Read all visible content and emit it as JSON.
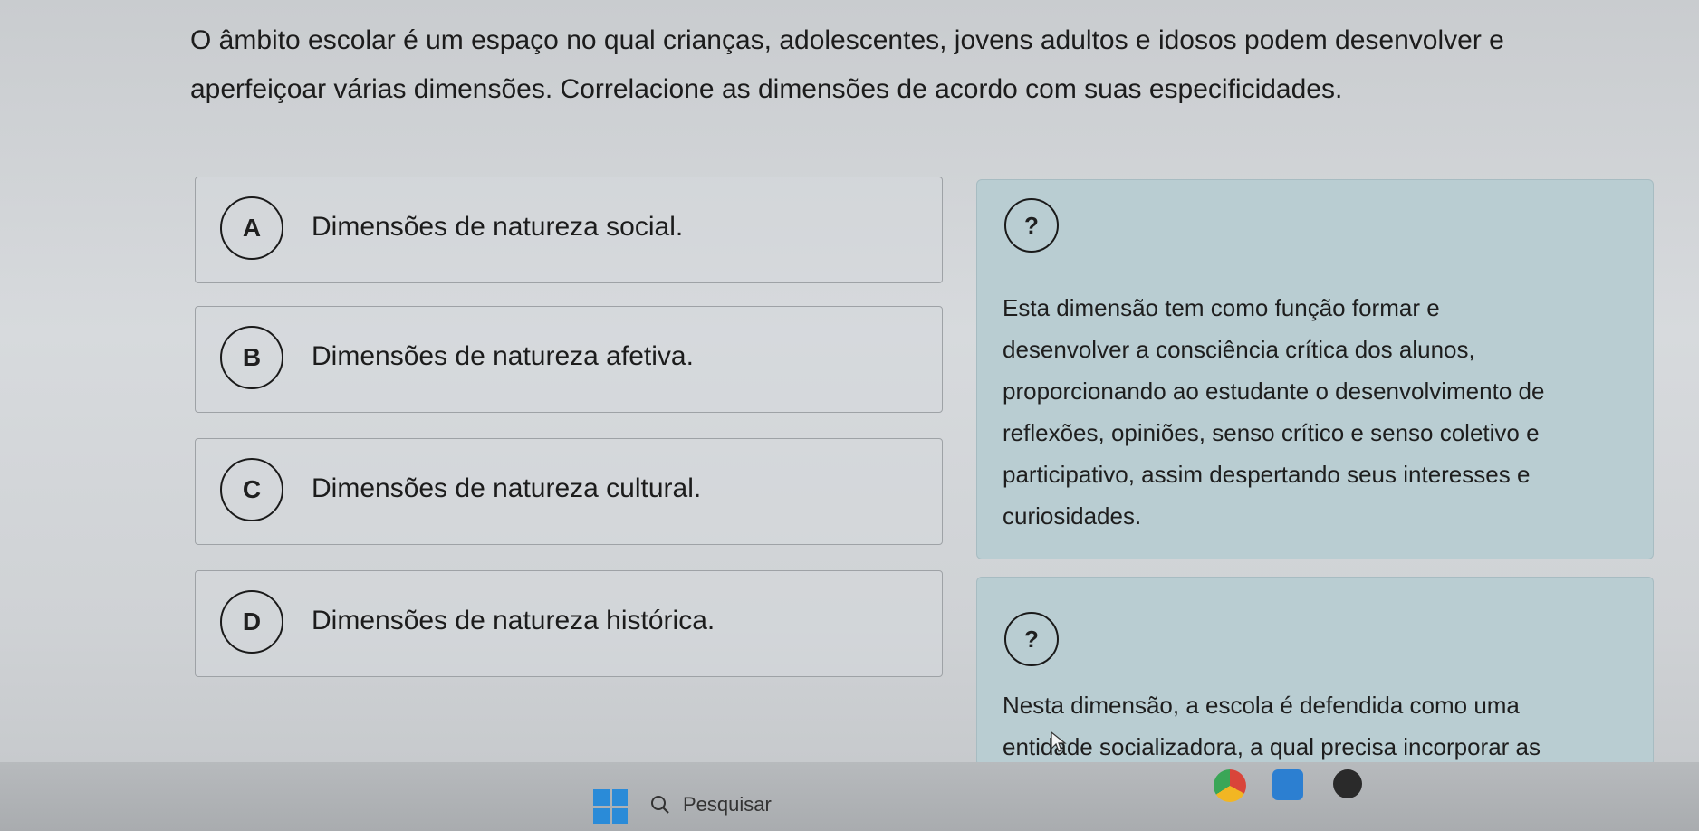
{
  "question": {
    "line1": "O âmbito escolar é um espaço no qual crianças, adolescentes, jovens adultos e idosos podem desenvolver e",
    "line2": "aperfeiçoar várias dimensões. Correlacione as dimensões de acordo com suas especificidades."
  },
  "options": [
    {
      "letter": "A",
      "text": "Dimensões de natureza social."
    },
    {
      "letter": "B",
      "text": "Dimensões de natureza afetiva."
    },
    {
      "letter": "C",
      "text": "Dimensões de natureza cultural."
    },
    {
      "letter": "D",
      "text": "Dimensões de natureza histórica."
    }
  ],
  "cards": [
    {
      "answer": "?",
      "lines": [
        "Esta dimensão tem como função formar e",
        "desenvolver a consciência crítica dos alunos,",
        "proporcionando ao estudante o desenvolvimento de",
        "reflexões, opiniões, senso crítico e senso coletivo e",
        "participativo, assim despertando seus interesses e",
        "curiosidades."
      ]
    },
    {
      "answer": "?",
      "lines": [
        "Nesta dimensão, a escola é defendida como uma",
        "entidade socializadora, a qual precisa incorporar as"
      ]
    }
  ],
  "taskbar": {
    "search_label": "Pesquisar",
    "icons": [
      "windows-start-icon",
      "search-icon",
      "chrome-icon",
      "photos-icon",
      "media-player-icon"
    ],
    "colors": {
      "windows_blue": "#2a8bd8",
      "card_bg": "#b9cdd2"
    }
  }
}
